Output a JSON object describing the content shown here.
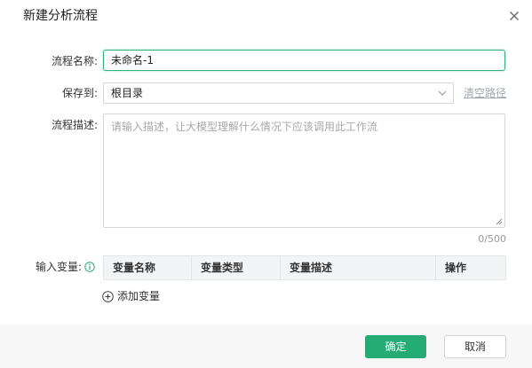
{
  "dialog": {
    "title": "新建分析流程",
    "close_icon": "close-icon"
  },
  "form": {
    "name_label": "流程名称:",
    "name_value": "未命名-1",
    "save_label": "保存到:",
    "save_value": "根目录",
    "clear_path": "清空路径",
    "desc_label": "流程描述:",
    "desc_placeholder": "请输入描述，让大模型理解什么情况下应该调用此工作流",
    "desc_counter": "0/500",
    "var_label": "输入变量:",
    "info_icon": "info-circle-icon"
  },
  "variables_table": {
    "columns": [
      "变量名称",
      "变量类型",
      "变量描述",
      "操作"
    ],
    "rows": []
  },
  "add_variable": {
    "icon": "plus-circle-icon",
    "label": "添加变量"
  },
  "footer": {
    "ok_label": "确定",
    "cancel_label": "取消"
  },
  "colors": {
    "accent": "#24ac74",
    "focus_border": "#2db47c",
    "link": "#a0a7b0",
    "table_header_bg": "#f3f4f6",
    "footer_bg": "#f7f7f7"
  }
}
